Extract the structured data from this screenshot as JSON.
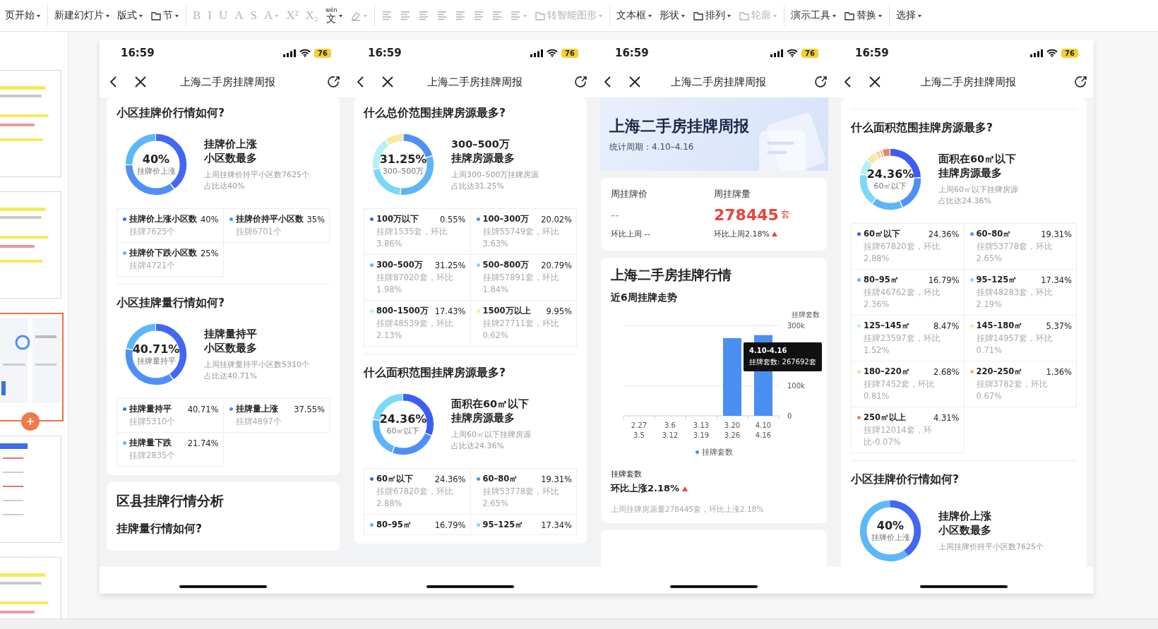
{
  "toolbar": [
    {
      "items": [
        {
          "kind": "label",
          "label": "页开始",
          "dropdown": true,
          "disabled": false
        }
      ]
    },
    {
      "items": [
        {
          "kind": "label",
          "label": "新建幻灯片",
          "dropdown": true,
          "disabled": false
        },
        {
          "kind": "label",
          "label": "版式",
          "dropdown": true,
          "disabled": false
        },
        {
          "kind": "iconlabel",
          "label": "节",
          "dropdown": true,
          "disabled": false
        }
      ]
    },
    {
      "items": [
        {
          "kind": "glyph",
          "label": "B",
          "dropdown": false,
          "disabled": true
        },
        {
          "kind": "glyph",
          "label": "I",
          "dropdown": false,
          "disabled": true
        },
        {
          "kind": "glyph",
          "label": "U",
          "dropdown": false,
          "disabled": true
        },
        {
          "kind": "glyph",
          "label": "A",
          "dropdown": false,
          "disabled": true
        },
        {
          "kind": "glyph",
          "label": "S",
          "dropdown": false,
          "disabled": true
        },
        {
          "kind": "glyph",
          "label": "A",
          "dropdown": true,
          "disabled": true
        },
        {
          "kind": "glyph",
          "label": "X²",
          "dropdown": false,
          "disabled": true
        },
        {
          "kind": "glyph",
          "label": "X₂",
          "dropdown": false,
          "disabled": true
        },
        {
          "kind": "ruby",
          "label": "文",
          "ruby": "wén",
          "dropdown": true,
          "disabled": false
        },
        {
          "kind": "tool",
          "dropdown": true,
          "disabled": true
        }
      ]
    },
    {
      "items": [
        {
          "kind": "lines",
          "dropdown": false,
          "disabled": true
        },
        {
          "kind": "lines",
          "dropdown": false,
          "disabled": true
        },
        {
          "kind": "lines",
          "dropdown": false,
          "disabled": true
        },
        {
          "kind": "lines",
          "dropdown": false,
          "disabled": true
        },
        {
          "kind": "lines",
          "dropdown": false,
          "disabled": true
        },
        {
          "kind": "lines",
          "dropdown": false,
          "disabled": true
        },
        {
          "kind": "lines",
          "dropdown": false,
          "disabled": true
        },
        {
          "kind": "lines",
          "dropdown": true,
          "disabled": true
        },
        {
          "kind": "iconlabel",
          "label": "转智能图形",
          "dropdown": true,
          "disabled": true
        }
      ]
    },
    {
      "items": [
        {
          "kind": "label",
          "label": "文本框",
          "dropdown": true,
          "disabled": false
        },
        {
          "kind": "label",
          "label": "形状",
          "dropdown": true,
          "disabled": false
        },
        {
          "kind": "iconlabel",
          "label": "排列",
          "dropdown": true,
          "disabled": false
        },
        {
          "kind": "iconlabel",
          "label": "轮廓",
          "dropdown": true,
          "disabled": true
        }
      ]
    },
    {
      "items": [
        {
          "kind": "label",
          "label": "演示工具",
          "dropdown": true,
          "disabled": false
        },
        {
          "kind": "iconlabel",
          "label": "替换",
          "dropdown": true,
          "disabled": false
        }
      ]
    },
    {
      "items": [
        {
          "kind": "label",
          "label": "选择",
          "dropdown": true,
          "disabled": false
        }
      ]
    }
  ],
  "thumbnails": [
    {
      "kind": "notes",
      "selected": false
    },
    {
      "kind": "notes",
      "selected": false
    },
    {
      "kind": "phones",
      "selected": true
    },
    {
      "kind": "table",
      "selected": false
    },
    {
      "kind": "notes",
      "selected": false
    }
  ],
  "phones": [
    {
      "status": {
        "time": "16:59",
        "battery": "76"
      },
      "nav": {
        "title": "上海二手房挂牌周报"
      },
      "cards": [
        {
          "blocks": [
            {
              "kind": "question",
              "text": "小区挂牌价行情如何?"
            },
            {
              "kind": "donut",
              "percent": "40%",
              "caption": "挂牌价上涨",
              "headline": [
                "挂牌价上涨",
                "小区数最多"
              ],
              "note": [
                "上周挂牌价持平小区数7625个",
                "占比达40%"
              ],
              "legend": [
                {
                  "name": "挂牌价上涨小区数",
                  "pct": "40%",
                  "sub": "挂牌7625个",
                  "color": "#4466f5"
                },
                {
                  "name": "挂牌价持平小区数",
                  "pct": "35%",
                  "sub": "挂牌6701个",
                  "color": "#4f90f6"
                },
                {
                  "name": "挂牌价下跌小区数",
                  "pct": "25%",
                  "sub": "挂牌4721个",
                  "color": "#5cb8f8"
                }
              ]
            },
            {
              "kind": "divider"
            },
            {
              "kind": "question",
              "text": "小区挂牌量行情如何?"
            },
            {
              "kind": "donut",
              "percent": "40.71%",
              "caption": "挂牌量持平",
              "headline": [
                "挂牌量持平",
                "小区数最多"
              ],
              "note": [
                "上周挂牌量持平小区数5310个",
                "占比达40.71%"
              ],
              "legend": [
                {
                  "name": "挂牌量持平",
                  "pct": "40.71%",
                  "sub": "挂牌5310个",
                  "color": "#4466f5"
                },
                {
                  "name": "挂牌量上涨",
                  "pct": "37.55%",
                  "sub": "挂牌4897个",
                  "color": "#4f90f6"
                },
                {
                  "name": "挂牌量下跌",
                  "pct": "21.74%",
                  "sub": "挂牌2835个",
                  "color": "#5cb8f8"
                }
              ]
            }
          ]
        },
        {
          "blocks": [
            {
              "kind": "section_title",
              "text": "区县挂牌行情分析"
            },
            {
              "kind": "question",
              "text": "挂牌量行情如何?"
            }
          ]
        }
      ]
    },
    {
      "status": {
        "time": "16:59",
        "battery": "76"
      },
      "nav": {
        "title": "上海二手房挂牌周报"
      },
      "cards": [
        {
          "blocks": [
            {
              "kind": "question",
              "text": "什么总价范围挂牌房源最多?"
            },
            {
              "kind": "donut",
              "percent": "31.25%",
              "caption": "300–500万",
              "headline": [
                "300–500万",
                "挂牌房源最多"
              ],
              "note": [
                "上周300–500万挂牌房源",
                "占比达31.25%"
              ],
              "legend": [
                {
                  "name": "100万以下",
                  "pct": "0.55%",
                  "sub": "挂牌1535套，环比3.86%",
                  "color": "#3d5cf5"
                },
                {
                  "name": "100–300万",
                  "pct": "20.02%",
                  "sub": "挂牌55749套，环比3.63%",
                  "color": "#4f90f6"
                },
                {
                  "name": "300–500万",
                  "pct": "31.25%",
                  "sub": "挂牌87020套，环比1.98%",
                  "color": "#5cb5f8"
                },
                {
                  "name": "500–800万",
                  "pct": "20.79%",
                  "sub": "挂牌57891套，环比1.84%",
                  "color": "#7dd8f7"
                },
                {
                  "name": "800–1500万",
                  "pct": "17.43%",
                  "sub": "挂牌48539套，环比2.13%",
                  "color": "#b5f0f5"
                },
                {
                  "name": "1500万以上",
                  "pct": "9.95%",
                  "sub": "挂牌27711套，环比0.62%",
                  "color": "#fbe8a0"
                }
              ]
            },
            {
              "kind": "divider"
            },
            {
              "kind": "question",
              "text": "什么面积范围挂牌房源最多?"
            },
            {
              "kind": "donut",
              "percent": "24.36%",
              "caption": "60㎡以下",
              "headline": [
                "面积在60㎡以下",
                "挂牌房源最多"
              ],
              "note": [
                "上周60㎡以下挂牌房源",
                "占比达24.36%"
              ],
              "legend": [
                {
                  "name": "60㎡以下",
                  "pct": "24.36%",
                  "sub": "挂牌67820套，环比2.88%",
                  "color": "#3d5cf5"
                },
                {
                  "name": "60–80㎡",
                  "pct": "19.31%",
                  "sub": "挂牌53778套，环比2.65%",
                  "color": "#4f90f6"
                },
                {
                  "name": "80–95㎡",
                  "pct": "16.79%",
                  "color": "#5cb5f8"
                },
                {
                  "name": "95–125㎡",
                  "pct": "17.34%",
                  "color": "#7dd8f7"
                }
              ]
            }
          ]
        }
      ]
    },
    {
      "status": {
        "time": "16:59",
        "battery": "76"
      },
      "nav": {
        "title": "上海二手房挂牌周报"
      },
      "cards": [
        {
          "blocks": [
            {
              "kind": "report_header",
              "title": "上海二手房挂牌周报",
              "period": "统计周期：4.10–4.16"
            }
          ]
        },
        {
          "blocks": [
            {
              "kind": "stats",
              "items": [
                {
                  "label": "周挂牌价",
                  "value": "--",
                  "change": "环比上周 --",
                  "rising": false,
                  "emphasis": false
                },
                {
                  "label": "周挂牌量",
                  "value": "278445",
                  "unit": "套",
                  "change": "环比上周2.18%",
                  "rising": true,
                  "emphasis": true
                }
              ]
            }
          ]
        },
        {
          "blocks": [
            {
              "kind": "chart",
              "title": "上海二手房挂牌行情",
              "subtitle": "近6周挂牌走势",
              "chart_data": {
                "type": "bar",
                "ylabel": "挂牌套数",
                "categories": [
                  "2.27\n3.5",
                  "3.6\n3.12",
                  "3.13\n3.19",
                  "3.20\n3.26",
                  "4.10\n4.16"
                ],
                "series": [
                  {
                    "name": "挂牌套数",
                    "color": "#4a8ff2",
                    "values": [
                      null,
                      null,
                      null,
                      258000,
                      268000
                    ]
                  }
                ],
                "ylim": [
                  0,
                  300000
                ],
                "yticks": [
                  0,
                  {
                    "value": 100000,
                    "label": "100k"
                  },
                  {
                    "value": 300000,
                    "label": "300k"
                  }
                ]
              },
              "tooltip": {
                "title": "4.10-4.16",
                "text": "挂牌套数: 267692套"
              },
              "metric": {
                "label": "挂牌套数",
                "change": "环比上涨2.18%",
                "rising": true
              },
              "note": "上周挂牌房源量278445套，环比上涨2.18%"
            }
          ]
        },
        {
          "blocks": [
            {
              "kind": "blank"
            }
          ]
        }
      ]
    },
    {
      "status": {
        "time": "16:59",
        "battery": "76"
      },
      "nav": {
        "title": "上海二手房挂牌周报"
      },
      "cards": [
        {
          "blocks": [
            {
              "kind": "divider"
            },
            {
              "kind": "question",
              "text": "什么面积范围挂牌房源最多?"
            },
            {
              "kind": "donut",
              "percent": "24.36%",
              "caption": "60㎡以下",
              "headline": [
                "面积在60㎡以下",
                "挂牌房源最多"
              ],
              "note": [
                "上周60㎡以下挂牌房源",
                "占比达24.36%"
              ],
              "legend": [
                {
                  "name": "60㎡以下",
                  "pct": "24.36%",
                  "sub": "挂牌67820套，环比2.88%",
                  "color": "#3d5cf5"
                },
                {
                  "name": "60–80㎡",
                  "pct": "19.31%",
                  "sub": "挂牌53778套，环比2.65%",
                  "color": "#4f90f6"
                },
                {
                  "name": "80–95㎡",
                  "pct": "16.79%",
                  "sub": "挂牌46762套，环比2.36%",
                  "color": "#5cb5f8"
                },
                {
                  "name": "95–125㎡",
                  "pct": "17.34%",
                  "sub": "挂牌48283套，环比2.19%",
                  "color": "#7dd8f7"
                },
                {
                  "name": "125–145㎡",
                  "pct": "8.47%",
                  "sub": "挂牌23597套，环比1.52%",
                  "color": "#b5f0f5"
                },
                {
                  "name": "145–180㎡",
                  "pct": "5.37%",
                  "sub": "挂牌14957套，环比0.71%",
                  "color": "#fbe8a0"
                },
                {
                  "name": "180–220㎡",
                  "pct": "2.68%",
                  "sub": "挂牌7452套，环比0.81%",
                  "color": "#f8d6a6"
                },
                {
                  "name": "220–250㎡",
                  "pct": "1.36%",
                  "sub": "挂牌3782套，环比0.67%",
                  "color": "#f4ae88"
                },
                {
                  "name": "250㎡以上",
                  "pct": "4.31%",
                  "sub": "挂牌12014套，环比-0.07%",
                  "color": "#ee8466"
                }
              ]
            },
            {
              "kind": "divider"
            },
            {
              "kind": "question",
              "text": "小区挂牌价行情如何?"
            },
            {
              "kind": "donut",
              "percent": "40%",
              "caption": "挂牌价上涨",
              "headline": [
                "挂牌价上涨",
                "小区数最多"
              ],
              "note": [
                "上周挂牌价持平小区数7625个"
              ]
            }
          ]
        }
      ]
    }
  ]
}
